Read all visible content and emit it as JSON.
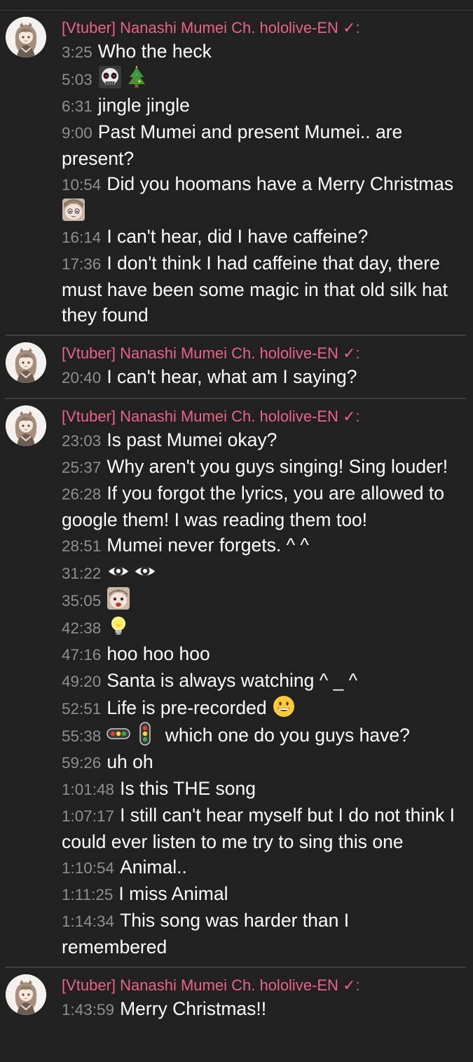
{
  "author": "[Vtuber] Nanashi Mumei Ch. hololive-EN",
  "verified": "✓:",
  "colors": {
    "author": "#e86489",
    "timestamp": "#8f8f8f",
    "background": "#212121"
  },
  "blocks": [
    {
      "messages": [
        {
          "time": "3:25",
          "text": "Who the heck"
        },
        {
          "time": "5:03",
          "text": "",
          "emotes": [
            "skull-face-emote",
            "christmas-tree-emote"
          ]
        },
        {
          "time": "6:31",
          "text": "jingle jingle"
        },
        {
          "time": "9:00",
          "text": "Past Mumei and present Mumei.. are present?"
        },
        {
          "time": "10:54",
          "text": "Did you hoomans have a Merry Christmas",
          "emotes_after": [
            "mumei-face-emote"
          ]
        },
        {
          "time": "16:14",
          "text": "I can't hear, did I have caffeine?"
        },
        {
          "time": "17:36",
          "text": "I don't think I had caffeine that day, there must have been some magic in that old silk hat they found"
        }
      ]
    },
    {
      "messages": [
        {
          "time": "20:40",
          "text": "I can't hear, what am I saying?"
        }
      ]
    },
    {
      "messages": [
        {
          "time": "23:03",
          "text": "Is past Mumei okay?"
        },
        {
          "time": "25:37",
          "text": "Why aren't you guys singing! Sing louder!"
        },
        {
          "time": "26:28",
          "text": "If you forgot the lyrics, you are allowed to google them! I was reading them too!"
        },
        {
          "time": "28:51",
          "text": "Mumei never forgets. ^ ^"
        },
        {
          "time": "31:22",
          "text": "",
          "emotes": [
            "eye-emote",
            "eye-emote"
          ]
        },
        {
          "time": "35:05",
          "text": "",
          "emotes": [
            "mumei-shock-emote"
          ]
        },
        {
          "time": "42:38",
          "text": "",
          "emotes": [
            "lightbulb-emote"
          ]
        },
        {
          "time": "47:16",
          "text": "hoo hoo hoo"
        },
        {
          "time": "49:20",
          "text": "Santa is always watching ^ _ ^"
        },
        {
          "time": "52:51",
          "text": "Life is pre-recorded",
          "emotes_after": [
            "grin-emote"
          ]
        },
        {
          "time": "55:38",
          "text": "which one do you guys have?",
          "emotes": [
            "traffic-light-horizontal-emote",
            "traffic-light-vertical-emote"
          ]
        },
        {
          "time": "59:26",
          "text": "uh oh"
        },
        {
          "time": "1:01:48",
          "text": "Is this THE song"
        },
        {
          "time": "1:07:17",
          "text": "I still can't hear myself but I do not think I could ever listen to me try to sing this one"
        },
        {
          "time": "1:10:54",
          "text": "Animal.."
        },
        {
          "time": "1:11:25",
          "text": "I miss Animal"
        },
        {
          "time": "1:14:34",
          "text": "This song was harder than I remembered"
        }
      ]
    },
    {
      "messages": [
        {
          "time": "1:43:59",
          "text": "Merry Christmas!!"
        }
      ]
    }
  ]
}
